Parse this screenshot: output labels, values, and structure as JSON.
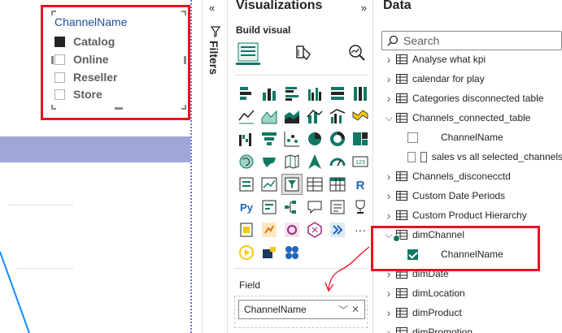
{
  "colors": {
    "highlight_red": "#e81123",
    "accent_teal": "#117865",
    "band_purple": "#9fa6d8",
    "slicer_title_blue": "#1f4e9e"
  },
  "slicer": {
    "title": "ChannelName",
    "items": [
      {
        "label": "Catalog",
        "checked": true
      },
      {
        "label": "Online",
        "checked": false
      },
      {
        "label": "Reseller",
        "checked": false
      },
      {
        "label": "Store",
        "checked": false
      }
    ]
  },
  "filters": {
    "label": "Filters",
    "collapse_icon": "double-chevron-left"
  },
  "visualizations": {
    "title": "Visualizations",
    "collapse_icon": "double-chevron-right",
    "build_visual_label": "Build visual",
    "tabs": [
      "build-visual",
      "format-visual",
      "analytics"
    ],
    "field_label": "Field",
    "field_value": "ChannelName",
    "more_label": "···"
  },
  "data": {
    "title": "Data",
    "search_placeholder": "Search",
    "tree": [
      {
        "label": "Analyse what kpi",
        "type": "table",
        "expanded": false
      },
      {
        "label": "calendar for play",
        "type": "table",
        "expanded": false
      },
      {
        "label": "Categories disconnected table",
        "type": "table",
        "expanded": false
      },
      {
        "label": "Channels_connected_table",
        "type": "table",
        "expanded": true
      },
      {
        "label": "ChannelName",
        "type": "field",
        "checked": false
      },
      {
        "label": "sales vs all selected_channels",
        "type": "measure-field",
        "checked": false
      },
      {
        "label": "Channels_disconecctd",
        "type": "table",
        "expanded": false
      },
      {
        "label": "Custom Date Periods",
        "type": "table",
        "expanded": false
      },
      {
        "label": "Custom Product Hierarchy",
        "type": "table",
        "expanded": false
      },
      {
        "label": "dimChannel",
        "type": "table",
        "expanded": true,
        "in_use": true
      },
      {
        "label": "ChannelName",
        "type": "field",
        "checked": true
      },
      {
        "label": "dimDate",
        "type": "table",
        "expanded": false
      },
      {
        "label": "dimLocation",
        "type": "table",
        "expanded": false
      },
      {
        "label": "dimProduct",
        "type": "table",
        "expanded": false
      },
      {
        "label": "dimPromotion",
        "type": "table",
        "expanded": false
      }
    ]
  }
}
